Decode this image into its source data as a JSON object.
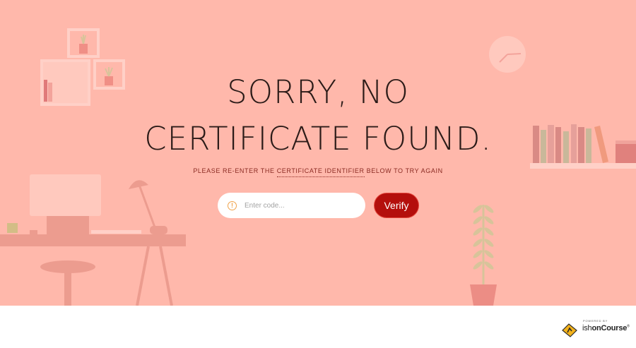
{
  "hero": {
    "headline_line1": "SORRY, NO",
    "headline_line2": "CERTIFICATE FOUND.",
    "instruction_prefix": "PLEASE RE-ENTER THE ",
    "instruction_link": "CERTIFICATE IDENTIFIER",
    "instruction_suffix": " BELOW TO TRY AGAIN"
  },
  "form": {
    "code_placeholder": "Enter code...",
    "code_value": "",
    "info_icon": "info-icon",
    "info_glyph": "!",
    "verify_label": "Verify"
  },
  "footer": {
    "powered_by": "POWERED BY",
    "logo_part1": "ish",
    "logo_part2": "onCourse",
    "trademark": "®",
    "logo_icon": "ish-logo-icon"
  },
  "colors": {
    "background": "#ffb8ab",
    "verify_button": "#b40f0c",
    "info_icon": "#f0a34b",
    "footer": "#ffffff"
  }
}
